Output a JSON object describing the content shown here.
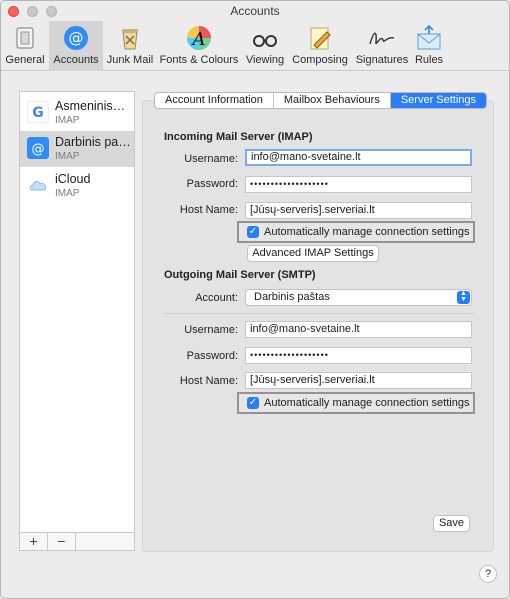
{
  "window": {
    "title": "Accounts"
  },
  "toolbar": {
    "items": [
      {
        "label": "General",
        "icon": "switch-icon"
      },
      {
        "label": "Accounts",
        "icon": "at-icon"
      },
      {
        "label": "Junk Mail",
        "icon": "trash-icon"
      },
      {
        "label": "Fonts & Colours",
        "icon": "font-icon"
      },
      {
        "label": "Viewing",
        "icon": "glasses-icon"
      },
      {
        "label": "Composing",
        "icon": "pencil-icon"
      },
      {
        "label": "Signatures",
        "icon": "signature-icon"
      },
      {
        "label": "Rules",
        "icon": "envelope-icon"
      }
    ],
    "selected": "Accounts"
  },
  "sidebar": {
    "accounts": [
      {
        "name": "Asmeninis…",
        "type": "IMAP",
        "icon": "google-icon"
      },
      {
        "name": "Darbinis pa…",
        "type": "IMAP",
        "icon": "at-icon"
      },
      {
        "name": "iCloud",
        "type": "IMAP",
        "icon": "cloud-icon"
      }
    ],
    "add_label": "+",
    "remove_label": "−"
  },
  "tabs": {
    "items": [
      "Account Information",
      "Mailbox Behaviours",
      "Server Settings"
    ],
    "active": "Server Settings"
  },
  "incoming": {
    "title": "Incoming Mail Server (IMAP)",
    "username_label": "Username:",
    "username": "info@mano-svetaine.lt",
    "password_label": "Password:",
    "password": "•••••••••••••••••••",
    "host_label": "Host Name:",
    "host": "[Jūsų-serveris].serveriai.lt",
    "auto_manage_label": "Automatically manage connection settings",
    "advanced_button": "Advanced IMAP Settings"
  },
  "outgoing": {
    "title": "Outgoing Mail Server (SMTP)",
    "account_label": "Account:",
    "account": "Darbinis paštas",
    "username_label": "Username:",
    "username": "info@mano-svetaine.lt",
    "password_label": "Password:",
    "password": "•••••••••••••••••••",
    "host_label": "Host Name:",
    "host": "[Jūsų-serveris].serveriai.lt",
    "auto_manage_label": "Automatically manage connection settings"
  },
  "save_button": "Save",
  "help_label": "?",
  "colors": {
    "accent": "#2a7df5",
    "highlight_border": "#9b8d9b",
    "close": "#fc5f57"
  }
}
